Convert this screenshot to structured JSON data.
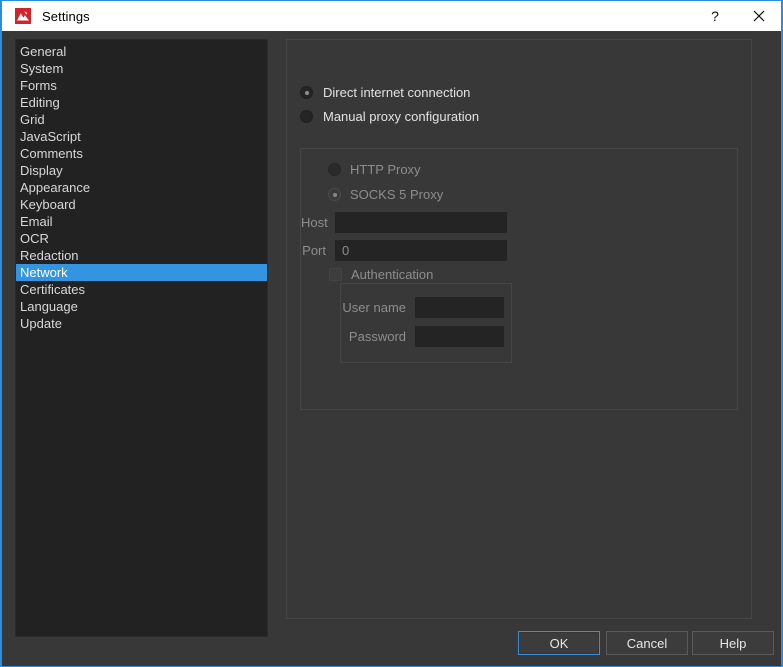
{
  "window": {
    "title": "Settings",
    "app_icon": "pdf-xchange-logo-icon",
    "help_button": "?",
    "close_button": "×",
    "accent_color": "#2a8ee0",
    "selection_color": "#3394e2",
    "titlebar_bg": "#ffffff",
    "body_bg": "#383838",
    "list_bg": "#222222"
  },
  "sidebar": {
    "items": [
      {
        "label": "General",
        "selected": false
      },
      {
        "label": "System",
        "selected": false
      },
      {
        "label": "Forms",
        "selected": false
      },
      {
        "label": "Editing",
        "selected": false
      },
      {
        "label": "Grid",
        "selected": false
      },
      {
        "label": "JavaScript",
        "selected": false
      },
      {
        "label": "Comments",
        "selected": false
      },
      {
        "label": "Display",
        "selected": false
      },
      {
        "label": "Appearance",
        "selected": false
      },
      {
        "label": "Keyboard",
        "selected": false
      },
      {
        "label": "Email",
        "selected": false
      },
      {
        "label": "OCR",
        "selected": false
      },
      {
        "label": "Redaction",
        "selected": false
      },
      {
        "label": "Network",
        "selected": true
      },
      {
        "label": "Certificates",
        "selected": false
      },
      {
        "label": "Language",
        "selected": false
      },
      {
        "label": "Update",
        "selected": false
      }
    ]
  },
  "network_page": {
    "connection_mode": {
      "options": [
        {
          "label": "Direct internet connection",
          "checked": true
        },
        {
          "label": "Manual proxy configuration",
          "checked": false
        }
      ]
    },
    "proxy_group": {
      "enabled": false,
      "proxy_type": {
        "options": [
          {
            "label": "HTTP Proxy",
            "checked": false
          },
          {
            "label": "SOCKS 5 Proxy",
            "checked": true
          }
        ]
      },
      "host": {
        "caption": "Host",
        "value": "",
        "placeholder": ""
      },
      "port": {
        "caption": "Port",
        "value": "0",
        "placeholder": ""
      },
      "authentication": {
        "label": "Authentication",
        "checked": false
      },
      "credentials": {
        "user_name": {
          "caption": "User name",
          "value": "",
          "placeholder": ""
        },
        "password": {
          "caption": "Password",
          "value": "",
          "placeholder": ""
        }
      }
    }
  },
  "footer": {
    "ok_label": "OK",
    "cancel_label": "Cancel",
    "help_label": "Help"
  }
}
